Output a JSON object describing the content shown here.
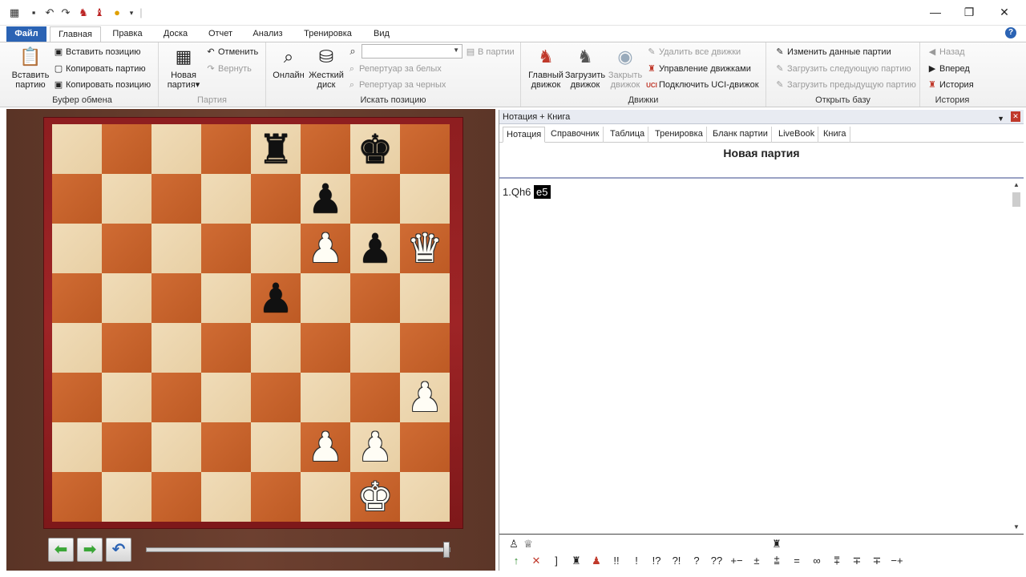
{
  "ribbon_tabs": [
    "Файл",
    "Главная",
    "Правка",
    "Доска",
    "Отчет",
    "Анализ",
    "Тренировка",
    "Вид"
  ],
  "clipboard": {
    "paste_label_line1": "Вставить",
    "paste_label_line2": "партию",
    "paste_position": "Вставить позицию",
    "copy_game": "Копировать партию",
    "copy_position": "Копировать позицию",
    "group": "Буфер обмена"
  },
  "game_group": {
    "new_line1": "Новая",
    "new_line2": "партия",
    "undo": "Отменить",
    "redo": "Вернуть",
    "group": "Партия"
  },
  "search_group": {
    "online": "Онлайн",
    "hdd_line1": "Жесткий",
    "hdd_line2": "диск",
    "in_game": "В партии",
    "rep_white": "Репертуар за белых",
    "rep_black": "Репертуар за черных",
    "group": "Искать позицию"
  },
  "engines_group": {
    "main_line1": "Главный",
    "main_line2": "движок",
    "load_line1": "Загрузить",
    "load_line2": "движок",
    "close_line1": "Закрыть",
    "close_line2": "движок",
    "remove_all": "Удалить все движки",
    "manage": "Управление движками",
    "uci": "Подключить UCI-движок",
    "group": "Движки"
  },
  "db_group": {
    "edit": "Изменить данные партии",
    "next": "Загрузить следующую партию",
    "prev": "Загрузить предыдущую партию",
    "group": "Открыть базу"
  },
  "history_group": {
    "back": "Назад",
    "forward": "Вперед",
    "history": "История",
    "group": "История"
  },
  "board": {
    "orientation": "white-bottom",
    "pieces": [
      {
        "square": "e8",
        "piece": "♜",
        "color": "b"
      },
      {
        "square": "g8",
        "piece": "♚",
        "color": "b"
      },
      {
        "square": "f7",
        "piece": "♟",
        "color": "b"
      },
      {
        "square": "f6",
        "piece": "♟",
        "color": "w"
      },
      {
        "square": "g6",
        "piece": "♟",
        "color": "b"
      },
      {
        "square": "h6",
        "piece": "♛",
        "color": "w"
      },
      {
        "square": "e5",
        "piece": "♟",
        "color": "b"
      },
      {
        "square": "h3",
        "piece": "♟",
        "color": "w"
      },
      {
        "square": "f2",
        "piece": "♟",
        "color": "w"
      },
      {
        "square": "g2",
        "piece": "♟",
        "color": "w"
      },
      {
        "square": "g1",
        "piece": "♚",
        "color": "w"
      }
    ]
  },
  "notation_pane": {
    "header": "Нотация + Книга",
    "tabs": [
      "Нотация",
      "Справочник",
      "Таблица",
      "Тренировка",
      "Бланк партии",
      "LiveBook",
      "Книга"
    ],
    "game_title": "Новая партия",
    "moves_prefix": "1.Qh6",
    "current_move": "e5"
  },
  "symbols_row1": [
    "♙",
    "♕",
    "♜"
  ],
  "symbols_row2": [
    "↑",
    "✕",
    "]",
    "♜",
    "♟",
    "!!",
    "!",
    "!?",
    "?!",
    "?",
    "??",
    "+−",
    "±",
    "⩲",
    "=",
    "∞",
    "⩱",
    "∓",
    "∓",
    "−+"
  ]
}
